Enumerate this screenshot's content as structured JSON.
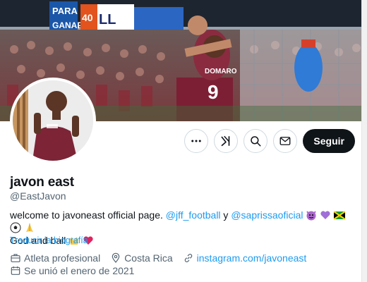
{
  "banner": {
    "description_icon": "stadium-celebration-photo",
    "signs": [
      "PARA",
      "GANAR",
      "40",
      "LL"
    ]
  },
  "jersey": {
    "player_name": "DOMARO",
    "number": "9"
  },
  "actions": {
    "more_icon": "more-horizontal-icon",
    "grok_icon": "grok-icon",
    "search_icon": "search-icon",
    "message_icon": "envelope-icon",
    "follow_label": "Seguir"
  },
  "profile": {
    "name": "javon east",
    "handle": "@EastJavon",
    "bio": {
      "text_1": "welcome to javoneast official page. ",
      "mention_1": "@jff_football",
      "text_2": " y ",
      "mention_2": "@saprissaoficial",
      "text_3": "God and ball"
    },
    "translate_label": "Traducir la biografía",
    "profession": "Atleta profesional",
    "location": "Costa Rica",
    "website": "instagram.com/javoneast",
    "joined": "Se unió el enero de 2021"
  },
  "colors": {
    "accent": "#1d9bf0",
    "text": "#0f1419",
    "muted": "#536471",
    "follow_bg": "#0f1419"
  }
}
